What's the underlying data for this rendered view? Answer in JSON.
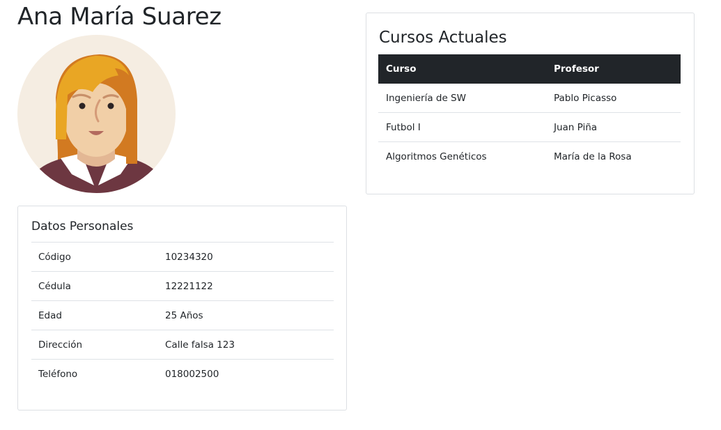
{
  "profile": {
    "name": "Ana María Suarez"
  },
  "colors": {
    "avatar_bg": "#f5ede2",
    "hair_dark": "#d27a21",
    "hair_light": "#e9a624",
    "skin": "#f1cfa7",
    "skin_shadow": "#e3b794",
    "shirt": "#6d3741",
    "collar": "#ffffff",
    "table_header_bg": "#212529",
    "border": "#dee2e6"
  },
  "personal": {
    "heading": "Datos Personales",
    "rows": [
      {
        "label": "Código",
        "value": "10234320"
      },
      {
        "label": "Cédula",
        "value": "12221122"
      },
      {
        "label": "Edad",
        "value": "25 Años"
      },
      {
        "label": "Dirección",
        "value": "Calle falsa 123"
      },
      {
        "label": "Teléfono",
        "value": "018002500"
      }
    ]
  },
  "courses": {
    "heading": "Cursos Actuales",
    "columns": [
      "Curso",
      "Profesor"
    ],
    "rows": [
      {
        "course": "Ingeniería de SW",
        "teacher": "Pablo Picasso"
      },
      {
        "course": "Futbol I",
        "teacher": "Juan Piña"
      },
      {
        "course": "Algoritmos Genéticos",
        "teacher": "María de la Rosa"
      }
    ]
  }
}
